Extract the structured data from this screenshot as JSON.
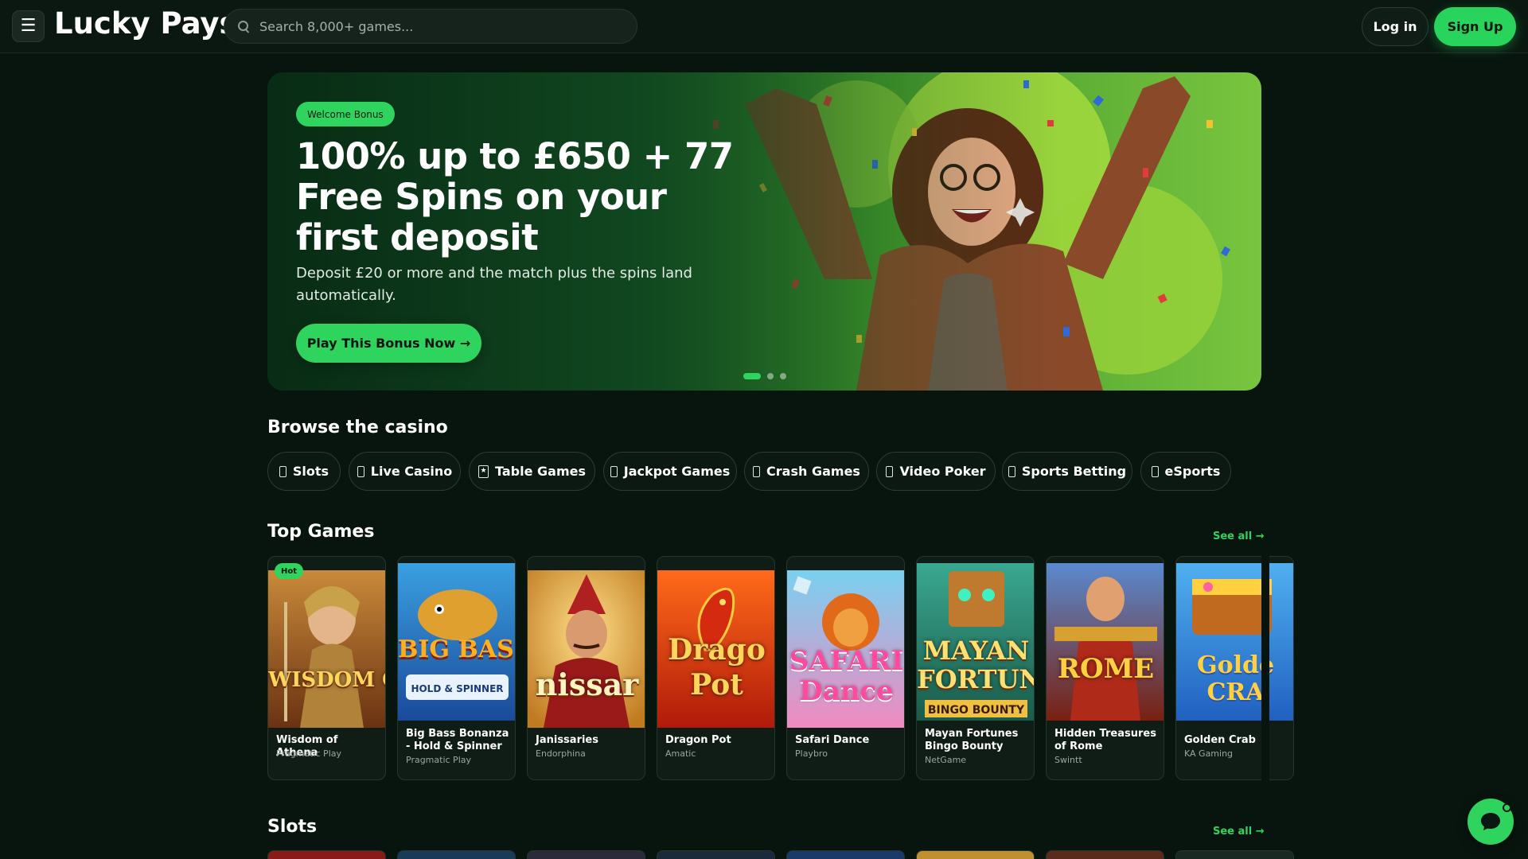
{
  "header": {
    "logo": "Lucky Pays",
    "search_placeholder": "Search 8,000+ games...",
    "login_label": "Log in",
    "signup_label": "Sign Up",
    "menu_icon": "hamburger-icon"
  },
  "hero": {
    "badge": "Welcome Bonus",
    "title": "100% up to £650 + 77 Free Spins on your first deposit",
    "subtitle": "Deposit £20 or more and the match plus the spins land automatically.",
    "cta": "Play This Bonus Now →",
    "slides_total": 3,
    "active_slide": 1
  },
  "browse": {
    "title": "Browse the casino",
    "categories": [
      {
        "label": "Slots",
        "icon": "slot-icon"
      },
      {
        "label": "Live Casino",
        "icon": "live-icon"
      },
      {
        "label": "Table Games",
        "icon": "card-icon"
      },
      {
        "label": "Jackpot Games",
        "icon": "jackpot-icon"
      },
      {
        "label": "Crash Games",
        "icon": "rocket-icon"
      },
      {
        "label": "Video Poker",
        "icon": "poker-icon"
      },
      {
        "label": "Sports Betting",
        "icon": "ball-icon"
      },
      {
        "label": "eSports",
        "icon": "gamepad-icon"
      }
    ]
  },
  "top_games": {
    "title": "Top Games",
    "see_all": "See all →",
    "games": [
      {
        "name": "Wisdom of Athena",
        "provider": "Pragmatic Play",
        "badge": "Hot",
        "art": "WISDOM OF ATHENA"
      },
      {
        "name": "Big Bass Bonanza - Hold & Spinner",
        "provider": "Pragmatic Play",
        "art": "BIG BASS"
      },
      {
        "name": "Janissaries",
        "provider": "Endorphina",
        "art": "nissar"
      },
      {
        "name": "Dragon Pot",
        "provider": "Amatic",
        "art": "Drago Pot"
      },
      {
        "name": "Safari Dance",
        "provider": "Playbro",
        "art": "SAFARI Dance"
      },
      {
        "name": "Mayan Fortunes Bingo Bounty",
        "provider": "NetGame",
        "art": "MAYAN FORTUNES"
      },
      {
        "name": "Hidden Treasures of Rome",
        "provider": "Swintt",
        "art": "ROME"
      },
      {
        "name": "Golden Crab",
        "provider": "KA Gaming",
        "art": "Golde CRA"
      }
    ]
  },
  "slots": {
    "title": "Slots",
    "see_all": "See all →"
  },
  "chat": {
    "icon": "chat-icon"
  },
  "colors": {
    "accent": "#2fd45e",
    "background": "#08150f"
  }
}
